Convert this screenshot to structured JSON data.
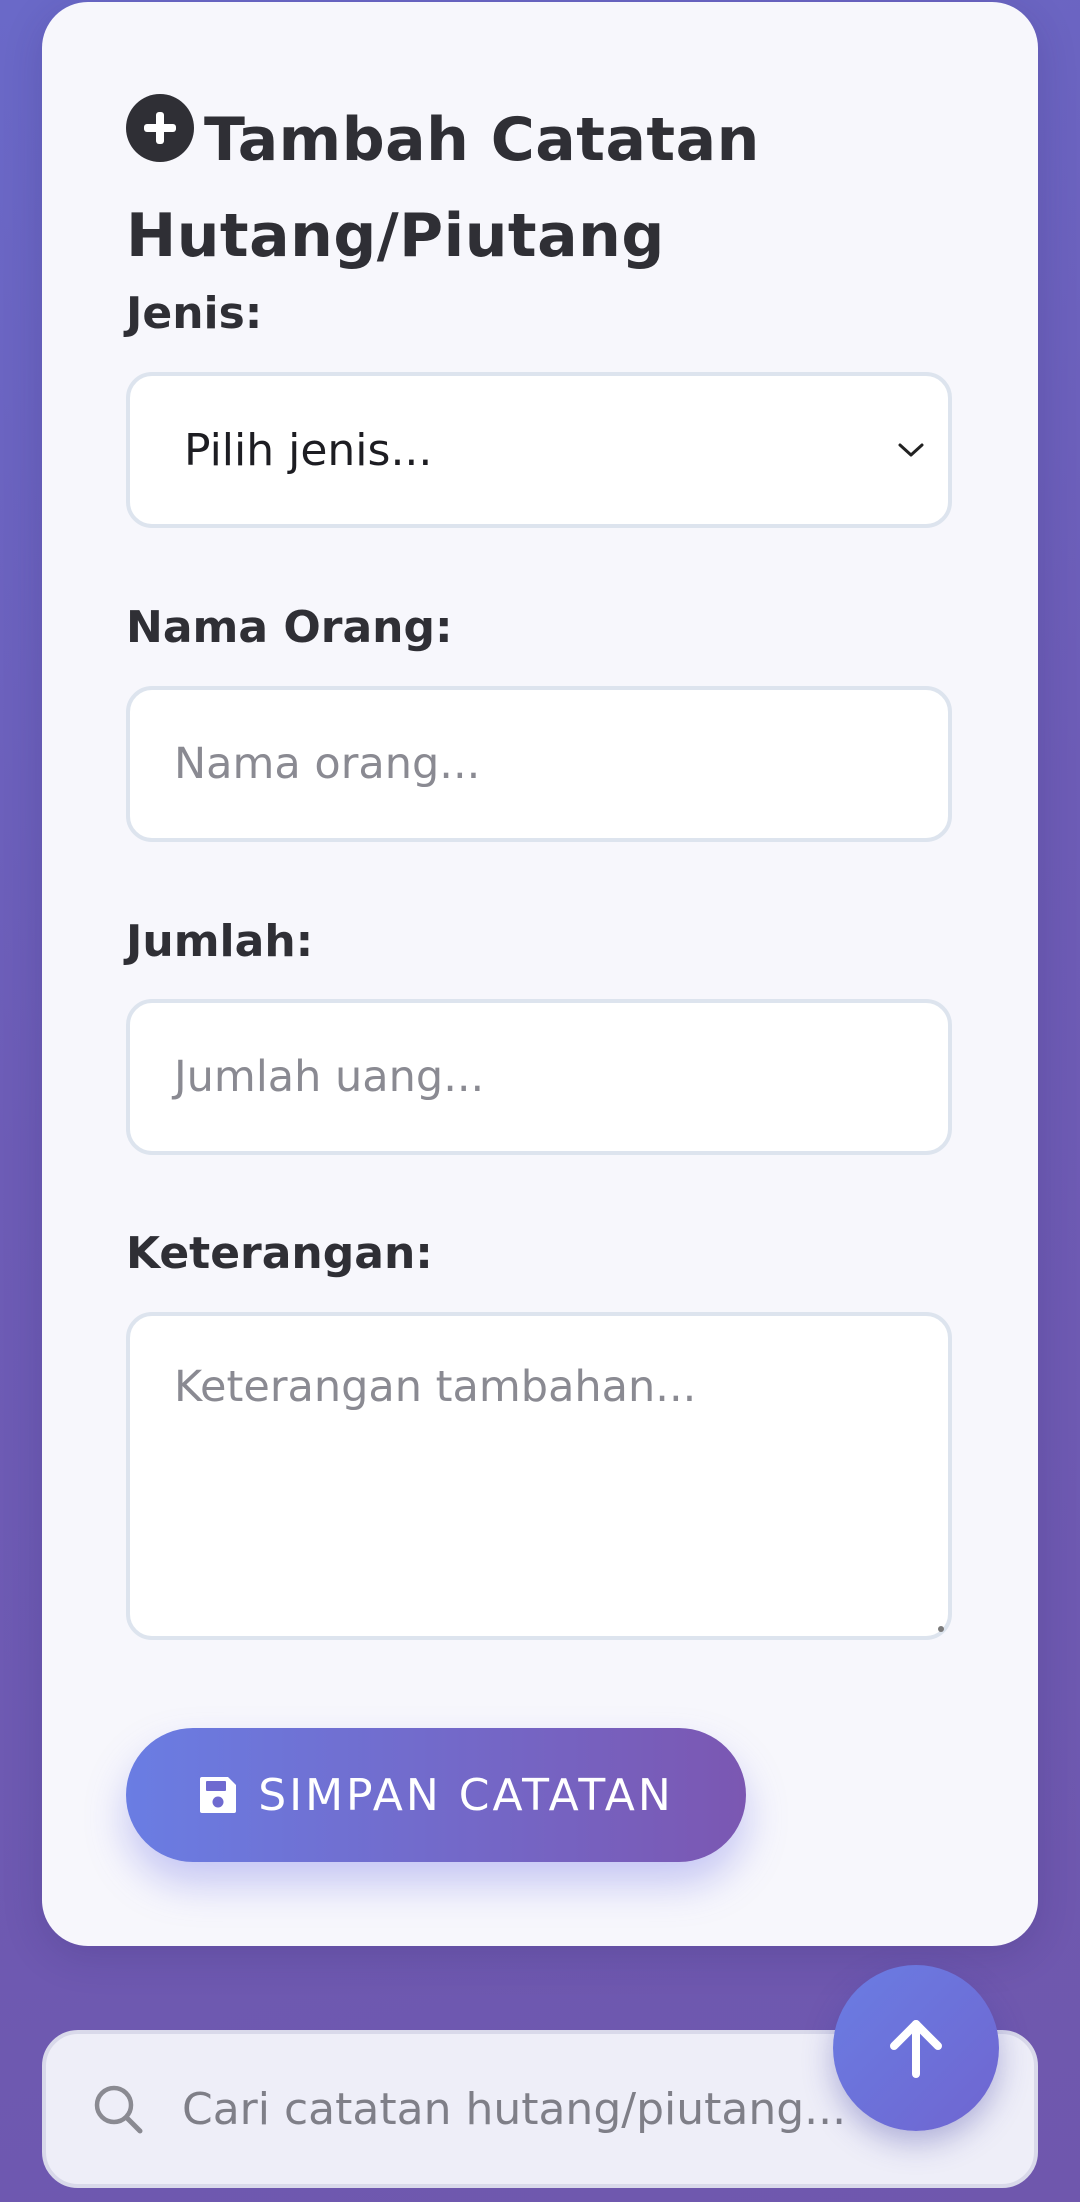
{
  "form": {
    "title": "Tambah Catatan Hutang/Piutang",
    "jenis_label": "Jenis:",
    "jenis_selected": "Pilih jenis...",
    "nama_label": "Nama Orang:",
    "nama_placeholder": "Nama orang...",
    "jumlah_label": "Jumlah:",
    "jumlah_placeholder": "Jumlah uang...",
    "keterangan_label": "Keterangan:",
    "keterangan_placeholder": "Keterangan tambahan...",
    "save_label": "SIMPAN CATATAN"
  },
  "search": {
    "placeholder": "Cari catatan hutang/piutang..."
  },
  "icons": {
    "title_icon": "plus-circle-icon",
    "select_icon": "chevron-down-icon",
    "save_icon": "floppy-disk-icon",
    "search_icon": "search-icon",
    "fab_icon": "arrow-up-icon"
  },
  "colors": {
    "background": "#6c5fb9",
    "accent_start": "#6a7de3",
    "accent_end": "#7b57b2",
    "card": "#f7f7fc",
    "text": "#2f2f35"
  }
}
